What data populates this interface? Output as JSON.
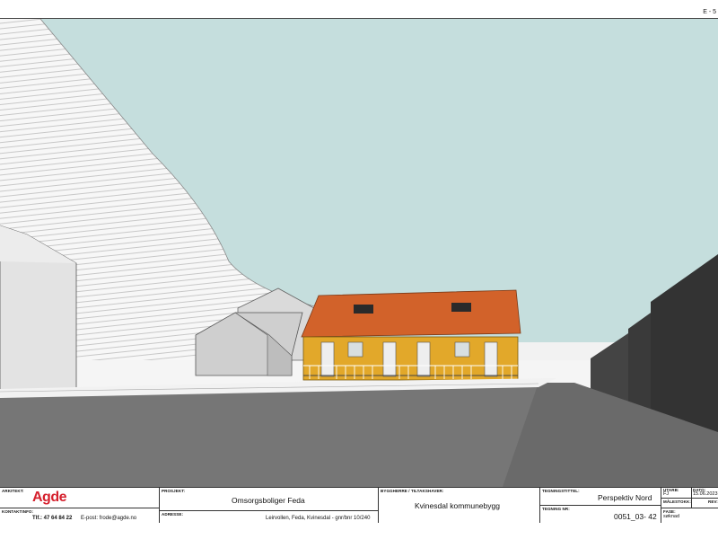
{
  "header": {
    "corner_mark": "E - 5"
  },
  "colors": {
    "sky": "#c5dedd",
    "roof": "#d2622a",
    "wall": "#e2a82a",
    "ground": "#767676",
    "dark_building": "#3d3d3d",
    "logo": "#d5202d"
  },
  "title_block": {
    "arkitekt_label": "ARKITEKT:",
    "logo_text": "Agde",
    "kontaktinfo_label": "KONTAKTINFO:",
    "phone": "Tlf.: 47 64 84 22",
    "email": "E-post: frode@agde.no",
    "prosjekt_label": "PROSJEKT:",
    "prosjekt": "Omsorgsboliger Feda",
    "adresse_label": "ADRESSE:",
    "adresse": "Leirvollen, Feda, Kvinesdal - gnr/bnr 10/240",
    "byggherre_label": "BYGGHERRE / TILTAKSHAVER:",
    "byggherre": "Kvinesdal kommunebygg",
    "tegningstittel_label": "TEGNINGSTITTEL:",
    "tegningstittel": "Perspektiv Nord",
    "tegning_nr_label": "TEGNING NR:",
    "tegning_nr": "0051_03- 42",
    "utarb_label": "UTARB:",
    "utarb": "FJ",
    "dato_label": "DATO:",
    "dato": "15.06.2023",
    "malestokk_label": "MÅLESTOKK:",
    "rev_label": "REV:",
    "fase_label": "FASE:",
    "fase": "søknad"
  }
}
